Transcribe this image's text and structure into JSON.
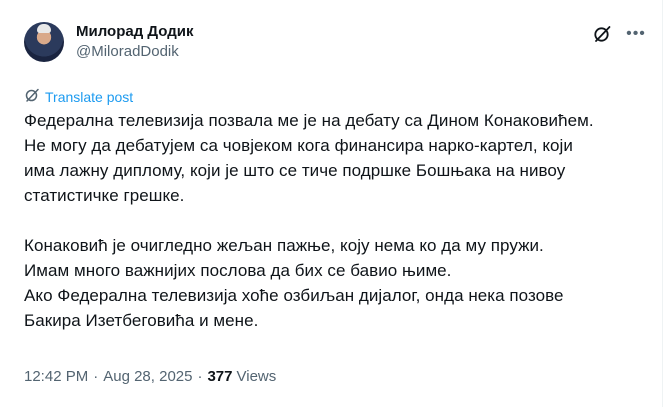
{
  "author": {
    "display_name": "Милорад Додик",
    "handle": "@MiloradDodik"
  },
  "icons": {
    "grok": "grok-icon",
    "more": "more-icon",
    "translate": "translate-icon"
  },
  "translate_label": "Translate post",
  "post": {
    "lines": [
      "Федерална телевизија позвала ме је на дебату са Дином Конаковићем.",
      "Не могу да дебатујем са човјеком кога финансира нарко-картел, који",
      "има лажну диплому, који је што се тиче подршке Бошњака на нивоу",
      "статистичке грешке."
    ],
    "lines2": [
      "Конаковић је очигледно жељан пажње, коју нема ко да му пружи.",
      "Имам много важнијих послова да бих се бавио њиме.",
      "Ако Федерална телевизија хоће озбиљан дијалог, онда нека позове",
      "Бакира Изетбеговића и мене."
    ]
  },
  "meta": {
    "time": "12:42 PM",
    "date": "Aug 28, 2025",
    "separator": "·",
    "views_count": "377",
    "views_label": "Views"
  },
  "colors": {
    "link": "#1d9bf0",
    "secondary_text": "#536471",
    "primary_text": "#0f1419"
  }
}
